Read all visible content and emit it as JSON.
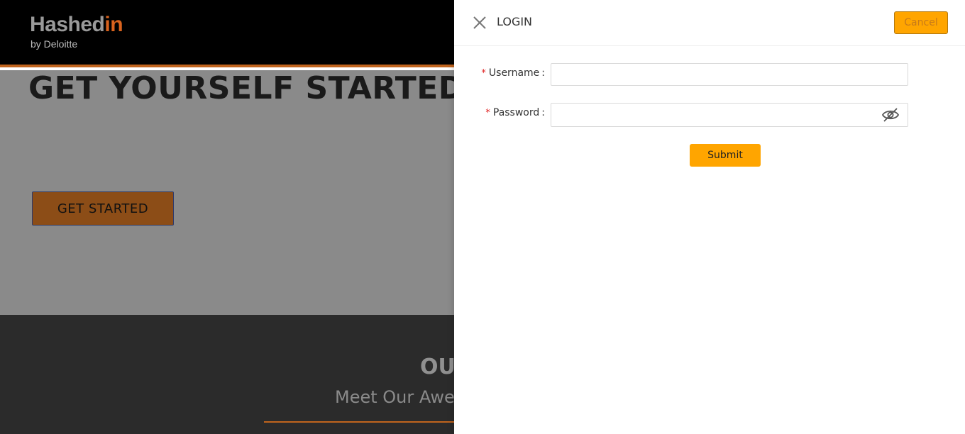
{
  "site": {
    "logo_main": "Hashed",
    "logo_accent": "in",
    "logo_sub": "by Deloitte",
    "hero_title": "GET YOURSELF STARTED ...",
    "get_started_label": "GET STARTED",
    "team_title": "OUR TEAM",
    "team_subtitle": "Meet Our Awesome Team"
  },
  "drawer": {
    "title": "LOGIN",
    "close_icon": "close-icon",
    "cancel_label": "Cancel",
    "fields": {
      "username": {
        "label": "Username",
        "required": "*",
        "value": "",
        "placeholder": ""
      },
      "password": {
        "label": "Password",
        "required": "*",
        "value": "",
        "placeholder": "",
        "toggle_icon": "eye-invisible-icon"
      }
    },
    "submit_label": "Submit"
  },
  "colors": {
    "accent": "#ffa500",
    "brand_orange": "#c0641d",
    "required": "#e02020"
  }
}
